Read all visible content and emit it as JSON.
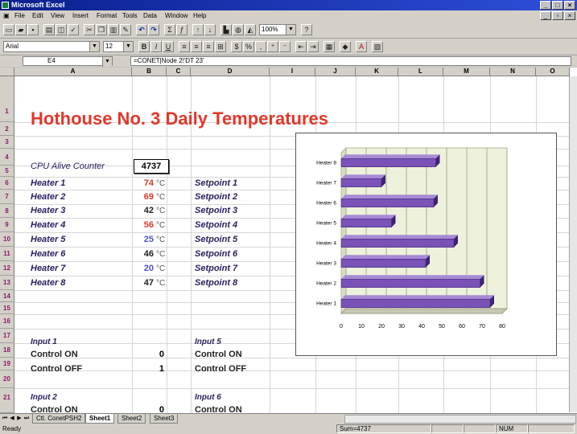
{
  "window": {
    "title": "Microsoft Excel"
  },
  "menu": [
    "File",
    "Edit",
    "View",
    "Insert",
    "Format",
    "Tools",
    "Data",
    "Window",
    "Help"
  ],
  "toolbar": {
    "zoom": "100%",
    "font": "Arial",
    "size": "12"
  },
  "formula_bar": {
    "name_box": "E4",
    "formula": "=CONET|Node 2!'DT 23'"
  },
  "columns": [
    "A",
    "B",
    "C",
    "D",
    "I",
    "J",
    "K",
    "L",
    "M",
    "N",
    "O"
  ],
  "rows": [
    "1",
    "2",
    "3",
    "4",
    "5",
    "6",
    "7",
    "8",
    "9",
    "10",
    "11",
    "12",
    "13",
    "14",
    "15",
    "16",
    "17",
    "18",
    "19",
    "20",
    "21"
  ],
  "sheet": {
    "title": "Hothouse No. 3 Daily Temperatures",
    "counter_label": "CPU Alive Counter",
    "counter_value": "4737",
    "unit": "°C",
    "heaters": [
      {
        "name": "Heater 1",
        "temp": "74",
        "color": "#e0382a",
        "setpoint": "Setpoint 1"
      },
      {
        "name": "Heater 2",
        "temp": "69",
        "color": "#e0382a",
        "setpoint": "Setpoint 2"
      },
      {
        "name": "Heater 3",
        "temp": "42",
        "color": "#222222",
        "setpoint": "Setpoint 3"
      },
      {
        "name": "Heater 4",
        "temp": "56",
        "color": "#e0382a",
        "setpoint": "Setpoint 4"
      },
      {
        "name": "Heater 5",
        "temp": "25",
        "color": "#5050d0",
        "setpoint": "Setpoint 5"
      },
      {
        "name": "Heater 6",
        "temp": "46",
        "color": "#222222",
        "setpoint": "Setpoint 6"
      },
      {
        "name": "Heater 7",
        "temp": "20",
        "color": "#5050d0",
        "setpoint": "Setpoint 7"
      },
      {
        "name": "Heater 8",
        "temp": "47",
        "color": "#222222",
        "setpoint": "Setpoint 8"
      }
    ],
    "input1": {
      "label": "Input 1",
      "on_label": "Control ON",
      "on_value": "0",
      "off_label": "Control OFF",
      "off_value": "1"
    },
    "input5": {
      "label": "Input 5",
      "on_label": "Control ON",
      "off_label": "Control OFF"
    },
    "input2": {
      "label": "Input 2",
      "on_label": "Control ON",
      "on_value": "0"
    },
    "input6": {
      "label": "Input 6",
      "on_label": "Control ON"
    }
  },
  "tabs": {
    "items": [
      "Ctl. ConetPSH2",
      "Sheet1",
      "Sheet2",
      "Sheet3"
    ],
    "active": 1
  },
  "status": {
    "ready": "Ready",
    "sum": "Sum=4737",
    "num": "NUM"
  },
  "chart_data": {
    "type": "bar",
    "orientation": "horizontal",
    "categories": [
      "Heater 1",
      "Heater 2",
      "Heater 3",
      "Heater 4",
      "Heater 5",
      "Heater 6",
      "Heater 7",
      "Heater 8"
    ],
    "values": [
      74,
      69,
      42,
      56,
      25,
      46,
      20,
      47
    ],
    "xlim": [
      0,
      80
    ],
    "xticks": [
      "0",
      "10",
      "20",
      "30",
      "40",
      "50",
      "60",
      "70",
      "80"
    ],
    "title": "",
    "xlabel": "",
    "ylabel": "",
    "grid": true,
    "bar_color": "#7a52b8"
  }
}
